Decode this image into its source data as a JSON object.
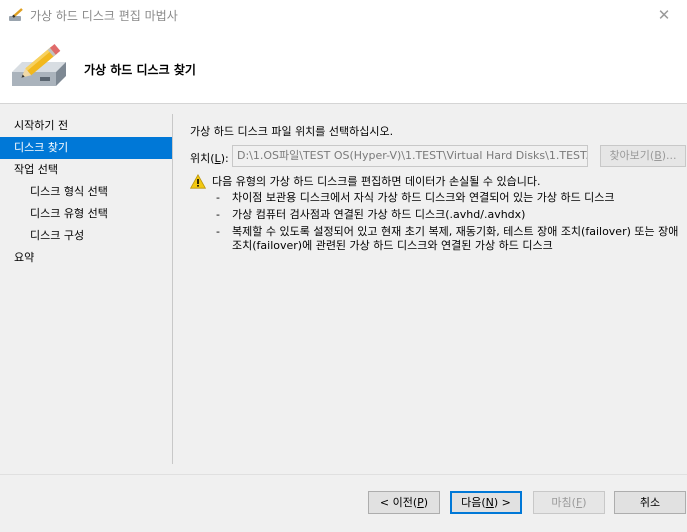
{
  "window": {
    "title": "가상 하드 디스크 편집 마법사",
    "close_glyph": "✕",
    "icon": "pencil-disk-icon"
  },
  "header": {
    "title": "가상 하드 디스크 찾기"
  },
  "sidebar": {
    "items": [
      {
        "label": "시작하기 전",
        "level": 0,
        "active": false
      },
      {
        "label": "디스크 찾기",
        "level": 0,
        "active": true
      },
      {
        "label": "작업 선택",
        "level": 0,
        "active": false
      },
      {
        "label": "디스크 형식 선택",
        "level": 1,
        "active": false
      },
      {
        "label": "디스크 유형 선택",
        "level": 1,
        "active": false
      },
      {
        "label": "디스크 구성",
        "level": 1,
        "active": false
      },
      {
        "label": "요약",
        "level": 0,
        "active": false
      }
    ]
  },
  "main": {
    "description": "가상 하드 디스크 파일 위치를 선택하십시오.",
    "location_label_prefix": "위치(",
    "location_label_key": "L",
    "location_label_suffix": "):",
    "location_value": "D:\\1.OS파일\\TEST OS(Hyper-V)\\1.TEST\\Virtual Hard Disks\\1.TEST.",
    "browse_prefix": "찾아보기(",
    "browse_key": "B",
    "browse_suffix": ")...",
    "warning": {
      "icon": "warning-icon",
      "text": "다음 유형의 가상 하드 디스크를 편집하면 데이터가 손실될 수 있습니다.",
      "bullets": [
        "차이점 보관용 디스크에서 자식 가상 하드 디스크와 연결되어 있는 가상 하드 디스크",
        "가상 컴퓨터 검사점과 연결된 가상 하드 디스크(.avhd/.avhdx)",
        "복제할 수 있도록 설정되어 있고 현재 초기 복제, 재동기화, 테스트 장애 조치(failover) 또는 장애 조치(failover)에 관련된 가상 하드 디스크와 연결된 가상 하드 디스크"
      ],
      "bullet_char": "-"
    }
  },
  "footer": {
    "prev": {
      "prefix": "< 이전(",
      "key": "P",
      "suffix": ")"
    },
    "next": {
      "prefix": "다음(",
      "key": "N",
      "suffix": ") >"
    },
    "finish": {
      "prefix": "마침(",
      "key": "F",
      "suffix": ")"
    },
    "cancel": "취소"
  },
  "colors": {
    "accent": "#0078d7",
    "warning": "#f2c811"
  }
}
